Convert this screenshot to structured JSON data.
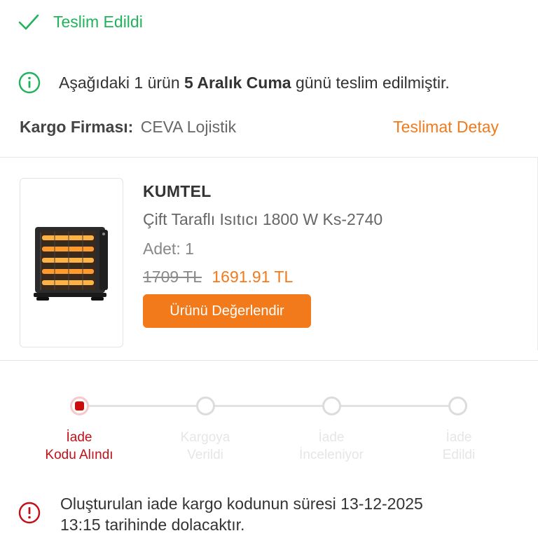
{
  "status": {
    "label": "Teslim Edildi",
    "icon": "check-icon",
    "color": "#21b35a"
  },
  "delivery_info": {
    "icon": "info-icon",
    "text_before": "Aşağıdaki 1 ürün",
    "date_bold": "5 Aralık Cuma",
    "text_after": "günü teslim edilmiştir."
  },
  "cargo": {
    "label": "Kargo Firması:",
    "company": "CEVA Lojistik",
    "detail_link": "Teslimat Detay"
  },
  "product": {
    "brand": "KUMTEL",
    "name": "Çift Taraflı Isıtıcı 1800 W Ks-2740",
    "quantity_label": "Adet:",
    "quantity_value": "1",
    "old_price": "1709 TL",
    "new_price": "1691.91 TL",
    "rate_button": "Ürünü Değerlendir",
    "image_icon": "heater-image"
  },
  "return_steps": [
    {
      "line1": "İade",
      "line2": "Kodu Alındı",
      "active": true
    },
    {
      "line1": "Kargoya",
      "line2": "Verildi",
      "active": false
    },
    {
      "line1": "İade",
      "line2": "İnceleniyor",
      "active": false
    },
    {
      "line1": "İade",
      "line2": "Edildi",
      "active": false
    }
  ],
  "return_warning": {
    "icon": "alert-icon",
    "line1": "Oluşturulan iade kargo kodunun süresi 13-12-2025",
    "line2": "13:15 tarihinde dolacaktır."
  },
  "colors": {
    "accent": "#f27a1a",
    "success": "#21b35a",
    "danger": "#c40e16"
  }
}
